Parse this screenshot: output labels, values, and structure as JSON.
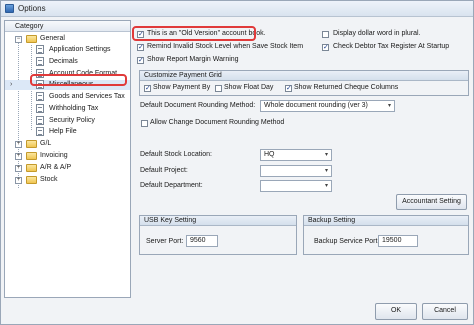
{
  "window": {
    "title": "Options"
  },
  "tree": {
    "header": "Category",
    "items": [
      {
        "label": "General"
      },
      {
        "label": "Application Settings"
      },
      {
        "label": "Decimals"
      },
      {
        "label": "Account Code Format"
      },
      {
        "label": "Miscellaneous"
      },
      {
        "label": "Goods and Services Tax"
      },
      {
        "label": "Withholding Tax"
      },
      {
        "label": "Security Policy"
      },
      {
        "label": "Help File"
      },
      {
        "label": "G/L"
      },
      {
        "label": "Invoicing"
      },
      {
        "label": "A/R & A/P"
      },
      {
        "label": "Stock"
      }
    ]
  },
  "options": {
    "old_version": {
      "label": "This is an \"Old Version\" account book.",
      "checked": true
    },
    "display_dollar_plural": {
      "label": "Display dollar word in plural.",
      "checked": false
    },
    "remind_invalid_stock": {
      "label": "Remind Invalid Stock Level when Save Stock Item",
      "checked": true
    },
    "check_debtor_tax": {
      "label": "Check Debtor Tax Register At Startup",
      "checked": true
    },
    "show_report_margin": {
      "label": "Show Report Margin Warning",
      "checked": true
    }
  },
  "payment_grid": {
    "title": "Customize Payment Grid",
    "show_payment_by": {
      "label": "Show Payment By",
      "checked": true
    },
    "show_float_day": {
      "label": "Show Float Day",
      "checked": false
    },
    "show_returned_cheque": {
      "label": "Show Returned Cheque Columns",
      "checked": true
    }
  },
  "rounding": {
    "label": "Default Document Rounding Method:",
    "value": "Whole document rounding (ver 3)",
    "allow_change": {
      "label": "Allow Change Document Rounding Method",
      "checked": false
    }
  },
  "defaults": {
    "stock_location": {
      "label": "Default Stock Location:",
      "value": "HQ"
    },
    "project": {
      "label": "Default Project:",
      "value": ""
    },
    "department": {
      "label": "Default Department:",
      "value": ""
    }
  },
  "accountant_setting_button": "Accountant Setting",
  "usb_key": {
    "title": "USB Key Setting",
    "port_label": "Server Port:",
    "port_value": "9560"
  },
  "backup": {
    "title": "Backup Setting",
    "port_label": "Backup Service Port:",
    "port_value": "19500"
  },
  "footer": {
    "ok": "OK",
    "cancel": "Cancel"
  },
  "icons": {
    "dropdown": "▾",
    "expand": "+",
    "collapse": "−",
    "check": "✓",
    "arrow": "›"
  }
}
